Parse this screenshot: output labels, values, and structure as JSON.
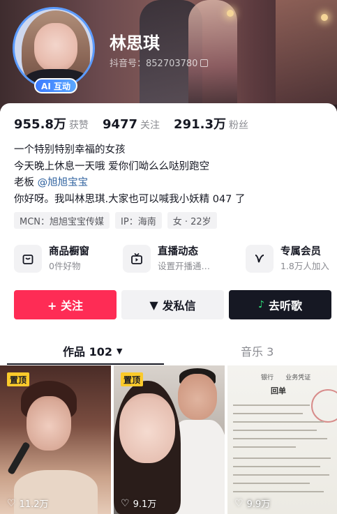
{
  "profile": {
    "name": "林思琪",
    "douyin_id": "抖音号：852703780",
    "ai_badge": "AI 互动"
  },
  "stats": [
    {
      "value": "955.8万",
      "label": "获赞"
    },
    {
      "value": "9477",
      "label": "关注"
    },
    {
      "value": "291.3万",
      "label": "粉丝"
    }
  ],
  "bio": {
    "line1": "一个特别特别幸福的女孩",
    "line2": "今天晚上休息一天哦 爱你们呦么么哒别跑空",
    "line3_prefix": "老板",
    "line3_mention": "@旭旭宝宝",
    "line4": "你好呀。我叫林思琪.大家也可以喊我小妖精 047 了"
  },
  "tags": [
    "MCN：旭旭宝宝传媒",
    "IP：海南",
    "女 · 22岁"
  ],
  "features": [
    {
      "title": "商品橱窗",
      "subtitle": "0件好物",
      "icon": "shopping-bag-icon"
    },
    {
      "title": "直播动态",
      "subtitle": "设置开播通…",
      "icon": "tv-icon"
    },
    {
      "title": "专属会员",
      "subtitle": "1.8万人加入",
      "icon": "v-badge-icon"
    }
  ],
  "actions": {
    "follow": "+ 关注",
    "message": "发私信",
    "music": "去听歌"
  },
  "tabs": {
    "works": "作品 102",
    "music": "音乐 3"
  },
  "videos": [
    {
      "pinned": "置顶",
      "likes": "11.2万"
    },
    {
      "pinned": "置顶",
      "likes": "9.1万"
    },
    {
      "likes": "9.9万",
      "doc_bank": "银行",
      "doc_sub": "业务凭证",
      "doc_title": "回单"
    }
  ],
  "colors": {
    "follow": "#fe2c55",
    "music_button": "#161823",
    "pin_badge": "#fbca2b",
    "ai_badge": "#3c7bff",
    "mention": "#2a5e9c"
  }
}
